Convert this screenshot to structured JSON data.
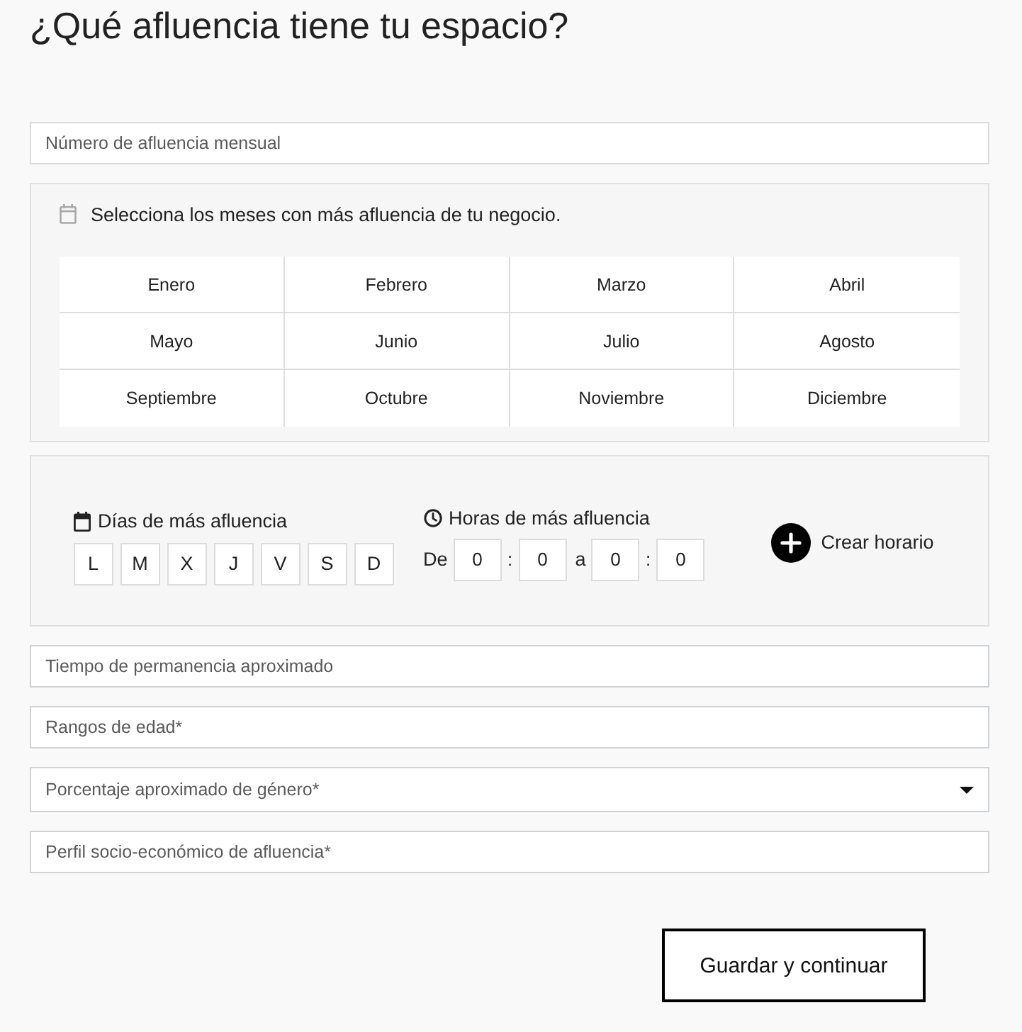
{
  "title": "¿Qué afluencia tiene tu espacio?",
  "monthly_traffic_field": {
    "placeholder": "Número de afluencia mensual"
  },
  "months_panel": {
    "prompt": "Selecciona los meses con más afluencia de tu negocio.",
    "months": [
      {
        "label": "Enero",
        "selected": false
      },
      {
        "label": "Febrero",
        "selected": false
      },
      {
        "label": "Marzo",
        "selected": false
      },
      {
        "label": "Abril",
        "selected": false
      },
      {
        "label": "Mayo",
        "selected": false
      },
      {
        "label": "Junio",
        "selected": false
      },
      {
        "label": "Julio",
        "selected": false
      },
      {
        "label": "Agosto",
        "selected": false
      },
      {
        "label": "Septiembre",
        "selected": false
      },
      {
        "label": "Octubre",
        "selected": false
      },
      {
        "label": "Noviembre",
        "selected": false
      },
      {
        "label": "Diciembre",
        "selected": false
      }
    ]
  },
  "schedule_panel": {
    "days_label": "Días de más afluencia",
    "days": [
      {
        "label": "L",
        "selected": false
      },
      {
        "label": "M",
        "selected": false
      },
      {
        "label": "X",
        "selected": false
      },
      {
        "label": "J",
        "selected": false
      },
      {
        "label": "V",
        "selected": false
      },
      {
        "label": "S",
        "selected": false
      },
      {
        "label": "D",
        "selected": false
      }
    ],
    "hours_label": "Horas de más afluencia",
    "from": {
      "label": "De",
      "hour": "0",
      "separator": ":",
      "minute": "0"
    },
    "to": {
      "label": "a",
      "hour": "0",
      "separator": ":",
      "minute": "0"
    },
    "add_schedule_button": "Crear horario"
  },
  "fields": [
    {
      "kind": "text",
      "placeholder": "Tiempo de permanencia aproximado"
    },
    {
      "kind": "text",
      "placeholder": "Rangos de edad*"
    },
    {
      "kind": "select",
      "placeholder": "Porcentaje aproximado de género*"
    },
    {
      "kind": "text",
      "placeholder": "Perfil socio-económico de afluencia*"
    }
  ],
  "save_button": "Guardar y continuar"
}
